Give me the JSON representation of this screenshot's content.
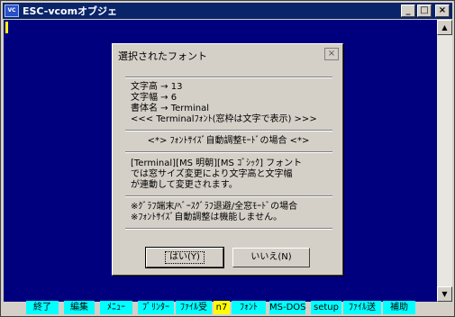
{
  "window": {
    "title": "ESC-vcomオブジェ",
    "icon": "app-icon"
  },
  "titlebar_buttons": {
    "minimize": "_",
    "maximize": "□",
    "close": "×"
  },
  "scrollbar": {
    "up": "▲",
    "down": "▼"
  },
  "fkeys": [
    {
      "label": "終了",
      "highlight": false
    },
    {
      "label": "編集",
      "highlight": false
    },
    {
      "label": "ﾒﾆｭｰ",
      "highlight": false
    },
    {
      "label": "ﾌﾟﾘﾝﾀｰ",
      "highlight": false
    },
    {
      "label": "ﾌｧｲﾙ受",
      "highlight": false
    },
    {
      "label": "n7",
      "highlight": true
    },
    {
      "label": "ﾌｫﾝﾄ",
      "highlight": false
    },
    {
      "label": "MS-DOS",
      "highlight": false
    },
    {
      "label": "setup",
      "highlight": false
    },
    {
      "label": "ﾌｧｲﾙ送",
      "highlight": false
    },
    {
      "label": "補助",
      "highlight": false
    }
  ],
  "dialog": {
    "title": "選択されたフォント",
    "close": "×",
    "height_line": "文字高 → 13",
    "width_line": "文字幅 → 6",
    "name_line": "書体名 → Terminal",
    "note_line": "<<< Terminalﾌｫﾝﾄ(窓枠は文字で表示) >>>",
    "mode_line": "<*> ﾌｫﾝﾄｻｲｽﾞ自動調整ﾓｰﾄﾞの場合 <*>",
    "desc1": "[Terminal][MS 明朝][MS ｺﾞｼｯｸ] フォント",
    "desc2": "では窓サイズ変更により文字高と文字幅",
    "desc3": "が連動して変更されます。",
    "warn1": "※ｸﾞﾗﾌ端末/ﾍﾞｰｽｸﾞﾗﾌ退避/全窓ﾓｰﾄﾞの場合",
    "warn2": "※ﾌｫﾝﾄｻｲｽﾞ自動調整は機能しません。",
    "yes_button": "はい(Y)",
    "no_button": "いいえ(N)"
  }
}
